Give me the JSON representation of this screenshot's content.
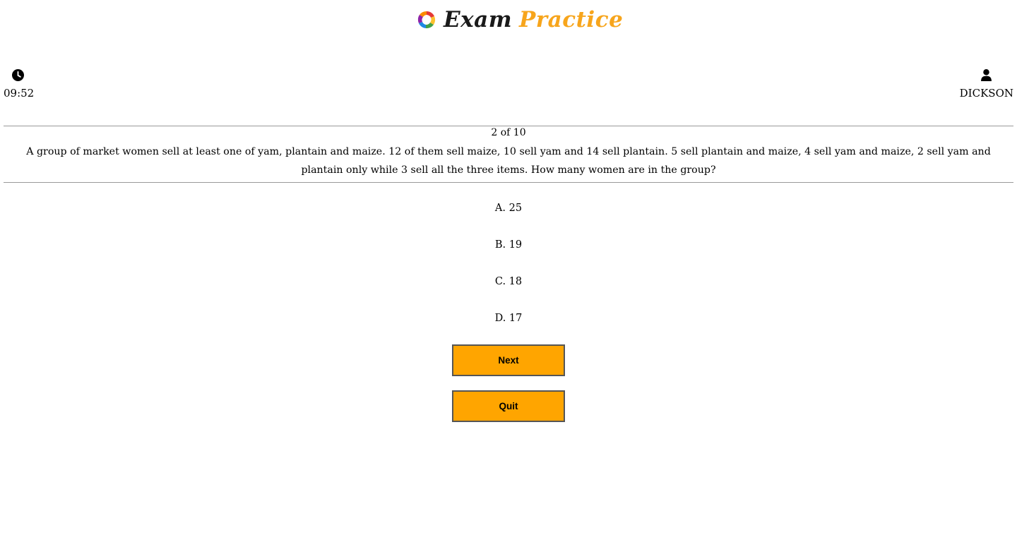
{
  "header": {
    "logo_word1": "Exam",
    "logo_word2": "Practice",
    "logo_icon": "colorful-spiral-logo-icon",
    "accent_color": "#f7a51c"
  },
  "timer": {
    "icon": "clock-icon",
    "value": "09:52"
  },
  "user": {
    "icon": "user-icon",
    "name": "DICKSON"
  },
  "question": {
    "progress": "2 of 10",
    "text": "A group of market women sell at least one of yam, plantain and maize. 12 of them sell maize, 10 sell yam and 14 sell plantain. 5 sell plantain and maize, 4 sell yam and maize, 2 sell yam and plantain only while 3 sell all the three items. How many women are in the group?"
  },
  "options": [
    {
      "label": "A. 25"
    },
    {
      "label": "B. 19"
    },
    {
      "label": "C. 18"
    },
    {
      "label": "D. 17"
    }
  ],
  "buttons": {
    "next_label": "Next",
    "quit_label": "Quit",
    "color": "#ffa500"
  }
}
